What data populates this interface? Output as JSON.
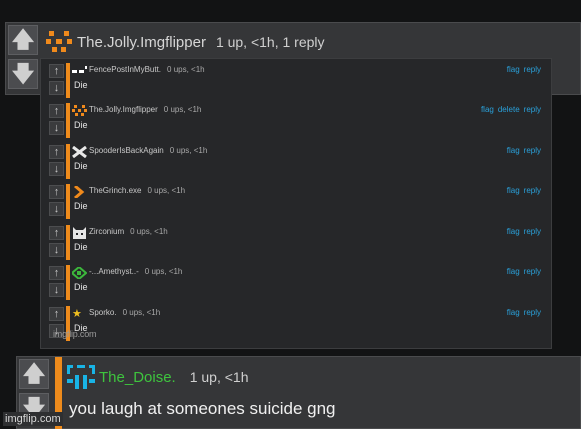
{
  "main_comment": {
    "username": "The.Jolly.Imgflipper",
    "meta": "1 up, <1h, 1 reply",
    "avatar_color": "#f08a1c"
  },
  "nested_replies": [
    {
      "username": "FencePostInMyButt.",
      "meta": "0 ups, <1h",
      "body": "Die",
      "actions": [
        "flag",
        "reply"
      ],
      "icon": "dash-icon"
    },
    {
      "username": "The.Jolly.Imgflipper",
      "meta": "0 ups, <1h",
      "body": "Die",
      "actions": [
        "flag",
        "delete",
        "reply"
      ],
      "icon": "pixel-face-icon"
    },
    {
      "username": "SpooderIsBackAgain",
      "meta": "0 ups, <1h",
      "body": "Die",
      "actions": [
        "flag",
        "reply"
      ],
      "icon": "cross-icon"
    },
    {
      "username": "TheGrinch.exe",
      "meta": "0 ups, <1h",
      "body": "Die",
      "actions": [
        "flag",
        "reply"
      ],
      "icon": "arrow-glyph-icon"
    },
    {
      "username": "Zirconium",
      "meta": "0 ups, <1h",
      "body": "Die",
      "actions": [
        "flag",
        "reply"
      ],
      "icon": "cat-icon"
    },
    {
      "username": "-...Amethyst..-",
      "meta": "0 ups, <1h",
      "body": "Die",
      "actions": [
        "flag",
        "reply"
      ],
      "icon": "green-pattern-icon"
    },
    {
      "username": "Sporko.",
      "meta": "0 ups, <1h",
      "body": "Die",
      "actions": [
        "flag",
        "reply"
      ],
      "icon": "star-icon"
    }
  ],
  "inner_watermark": "imgflip.com",
  "reply": {
    "username": "The_Doise.",
    "meta": "1 up, <1h",
    "text": "you laugh at someones suicide gng",
    "username_color": "#3ec43e"
  },
  "watermark": "imgflip.com",
  "colors": {
    "accent_bar": "#ee8b1c",
    "link": "#2aa0d9",
    "background": "#121314",
    "panel": "#353638"
  }
}
